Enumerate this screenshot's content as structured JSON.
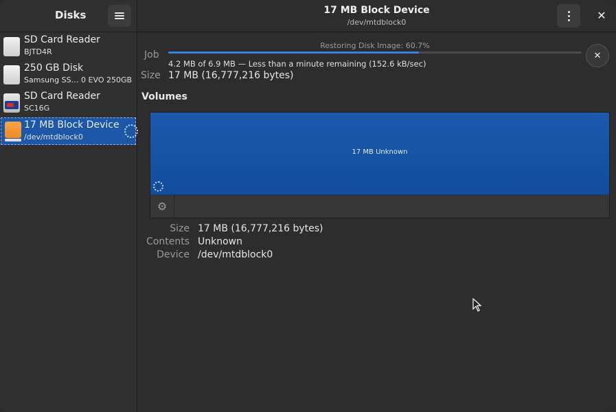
{
  "sidebar": {
    "title": "Disks",
    "devices": [
      {
        "name": "SD Card Reader",
        "sub": "BJTD4R",
        "icon": "card-reader-icon"
      },
      {
        "name": "250 GB Disk",
        "sub": "Samsung SS… 0 EVO 250GB",
        "icon": "disk-icon"
      },
      {
        "name": "SD Card Reader",
        "sub": "SC16G",
        "icon": "sd-card-icon"
      },
      {
        "name": "17 MB Block Device",
        "sub": "/dev/mtdblock0",
        "icon": "block-device-icon"
      }
    ]
  },
  "header": {
    "title": "17 MB Block Device",
    "subtitle": "/dev/mtdblock0"
  },
  "job": {
    "label": "Job",
    "status": "Restoring Disk Image: 60.7%",
    "progress": 0.607,
    "detail": "4.2 MB of 6.9 MB — Less than a minute remaining (152.6 kB/sec)"
  },
  "size": {
    "label": "Size",
    "value": "17 MB (16,777,216 bytes)"
  },
  "volumes": {
    "title": "Volumes",
    "partition_label": "17 MB Unknown"
  },
  "details": {
    "size_label": "Size",
    "size_value": "17 MB (16,777,216 bytes)",
    "contents_label": "Contents",
    "contents_value": "Unknown",
    "device_label": "Device",
    "device_value": "/dev/mtdblock0"
  },
  "colors": {
    "accent": "#3584e4",
    "selection": "#1c57a8",
    "partition": "#1a5aac"
  }
}
